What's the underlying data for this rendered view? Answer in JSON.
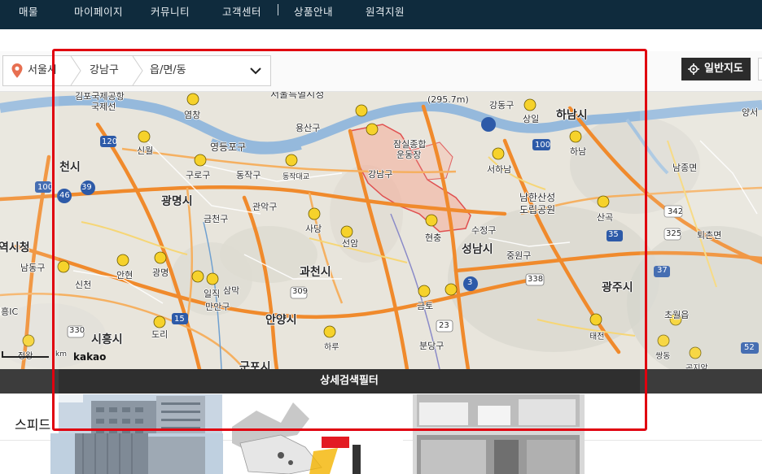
{
  "topnav": {
    "items": [
      "매물",
      "마이페이지",
      "커뮤니티",
      "고객센터",
      "상품안내",
      "원격지원"
    ]
  },
  "filterbar": {
    "crumbs": [
      "서울시",
      "강남구",
      "읍/면/동"
    ],
    "map_button_label": "일반지도"
  },
  "map": {
    "labels": [
      "김포국제공항",
      "국제선",
      "서울특별시청",
      "(295.7m)",
      "강동구",
      "하남시",
      "양서",
      "염창",
      "용산구",
      "잠실종합",
      "운동장",
      "상일",
      "영등포구",
      "신월",
      "120",
      "100",
      "하남",
      "천시",
      "구로구",
      "동작구",
      "동작대교",
      "강남구",
      "서하남",
      "남종면",
      "46",
      "39",
      "광명시",
      "남한산성",
      "도립공원",
      "342",
      "100",
      "금천구",
      "관악구",
      "사당",
      "수정구",
      "산곡",
      "역시청",
      "남동구",
      "선암",
      "현충",
      "35",
      "325",
      "퇴촌면",
      "중원구",
      "신천",
      "안현",
      "광명",
      "과천시",
      "성남시",
      "338",
      "37",
      "시흥IC",
      "일직",
      "삼막",
      "309",
      "3",
      "광주시",
      "만안구",
      "금토",
      "15",
      "초월읍",
      "330",
      "시흥시",
      "도리",
      "안양시",
      "23",
      "태전",
      "하루",
      "정왕",
      "군포시",
      "분당구",
      "쌍동",
      "52",
      "곤지암"
    ],
    "attribution": "kakao",
    "scale_label": "km",
    "filter_bar_label": "상세검색필터"
  },
  "below": {
    "speed_label": "스피드"
  },
  "colors": {
    "nav_bg": "#0f2b3d",
    "highlight_red": "#e0000f",
    "region_fill": "#f6b3a3",
    "road_orange": "#f08a2c",
    "river_blue": "#8fb4d9"
  }
}
